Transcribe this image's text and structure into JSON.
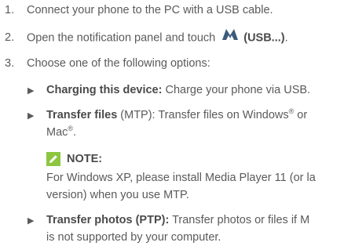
{
  "steps": [
    {
      "num": "1.",
      "text": "Connect your phone to the PC with a USB cable."
    },
    {
      "num": "2.",
      "text_before": "Open the notification panel and touch",
      "bold": "(USB...)",
      "after": "."
    },
    {
      "num": "3.",
      "text": "Choose one of the following options:"
    }
  ],
  "options": [
    {
      "bold": "Charging this device:",
      "text": " Charge your phone via USB."
    },
    {
      "bold": "Transfer files",
      "text": " (MTP): Transfer files on Windows",
      "reg": "®",
      "tail": " or",
      "line2": "Mac",
      "line2_reg": "®",
      "line2_tail": "."
    },
    {
      "bold": "Transfer photos (PTP):",
      "text": " Transfer photos or files if M",
      "line2": "is not supported by your computer."
    }
  ],
  "note": {
    "label": "NOTE:",
    "line1": "For Windows XP, please install Media Player 11 (or la",
    "line2": "version) when you use MTP."
  },
  "colors": {
    "note_icon": "#8cc63f",
    "android_icon": "#3b5b7c"
  },
  "icons": {
    "note": "pencil-icon",
    "android": "android-n-icon"
  }
}
